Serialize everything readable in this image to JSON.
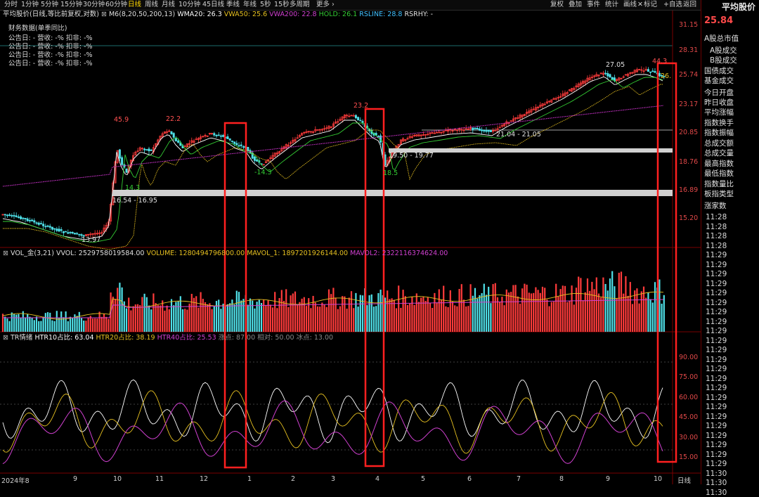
{
  "toolbar": {
    "periods": [
      "分时",
      "1分钟",
      "5分钟",
      "15分钟",
      "30分钟",
      "60分钟",
      "日线",
      "周线",
      "月线",
      "10分钟",
      "45日线",
      "季线",
      "年线",
      "5秒",
      "15秒",
      "多周期",
      "更多"
    ],
    "active_period": "日线",
    "actions": [
      "复权",
      "叠加",
      "事件",
      "统计",
      "画线",
      "标记",
      "+自选",
      "返回"
    ],
    "close_icon": "close-icon"
  },
  "right_panel": {
    "title": "平均股价",
    "price": "25.84",
    "items": [
      "A股总市值",
      "A股成交",
      "B股成交",
      "国债成交",
      "基金成交",
      "今日开盘",
      "昨日收盘",
      "平均涨幅",
      "指数换手",
      "指数振幅",
      "总成交额",
      "总成交量",
      "最高指数",
      "最低指数",
      "指数量比",
      "板指类型",
      "涨家数"
    ],
    "times": [
      "11:28",
      "11:28",
      "11:28",
      "11:28",
      "11:29",
      "11:29",
      "11:29",
      "11:29",
      "11:29",
      "11:29",
      "11:29",
      "11:29",
      "11:29",
      "11:29",
      "11:29",
      "11:29",
      "11:29",
      "11:29",
      "11:29",
      "11:29",
      "11:29",
      "11:29",
      "11:29",
      "11:29",
      "11:29",
      "11:29",
      "11:29",
      "11:30",
      "11:30",
      "11:30"
    ]
  },
  "price_panel": {
    "header": {
      "name": "平均股价(日线,等比前复权,对数)",
      "ma": "M6(8,20,50,200,13)",
      "wma20": "WMA20: 26.3",
      "vwa50": "VWA50: 25.6",
      "vwa200": "VWA200: 22.8",
      "hold": "HOLD: 26.1",
      "rsline": "RSLINE: 28.8",
      "rsrhy": "RSRHY: -"
    },
    "finance": {
      "title": "财务数据(单季同比)",
      "rows": [
        "公告日: -  营收: -%  扣非: -%",
        "公告日: -  营收: -%  扣非: -%",
        "公告日: -  营收: -%  扣非: -%",
        "公告日: -  营收: -%  扣非: -%"
      ]
    },
    "y_ticks": [
      "31.15",
      "28.31",
      "25.74",
      "23.17",
      "20.85",
      "18.76",
      "16.89",
      "15.20"
    ],
    "annotations": {
      "low_start": "13.97",
      "high_oct": "45.9",
      "pt_143a": "14.3",
      "zone_low": "16.54 - 16.95",
      "high_nov": "22.2",
      "low_jan": "-14.3",
      "high_mar": "23.2",
      "low_apr": "18.5",
      "zone_mid": "19.50 - 19.77",
      "zone_high": "21.04 - 21.05",
      "high_sep": "27.05",
      "high_end": "44.3",
      "last": "26."
    },
    "colors": {
      "up": "#ff3b3b",
      "down": "#4fe0e8",
      "ma8": "#ffffff",
      "ma20": "#33cc33",
      "ma50": "#e6c020",
      "ma200": "#cc33cc",
      "box": "#ff2020"
    }
  },
  "volume_panel": {
    "header": {
      "name": "VOL_金(3,21)",
      "vvol": "VVOL: 2529758019584.00",
      "volume": "VOLUME: 1280494796800.00",
      "mavol1": "MAVOL_1: 1897201926144.00",
      "mavol2": "MAVOL2: 2322116374624.00"
    }
  },
  "tr_panel": {
    "header": {
      "name": "TR情绪",
      "htr10": "HTR10占比: 63.04",
      "htr20": "HTR20占比: 38.19",
      "htr40": "HTR40占比: 25.53",
      "zhang": "涨点: 87.00",
      "xiang": "相对: 50.00",
      "bing": "冰点: 13.00"
    },
    "y_ticks": [
      "90.00",
      "75.00",
      "60.00",
      "45.00",
      "30.00",
      "15.00"
    ]
  },
  "x_axis": {
    "labels": [
      "2024年8",
      "9",
      "10",
      "11",
      "12",
      "1",
      "2",
      "3",
      "4",
      "5",
      "6",
      "7",
      "8",
      "9",
      "10"
    ],
    "unit": "日线"
  }
}
